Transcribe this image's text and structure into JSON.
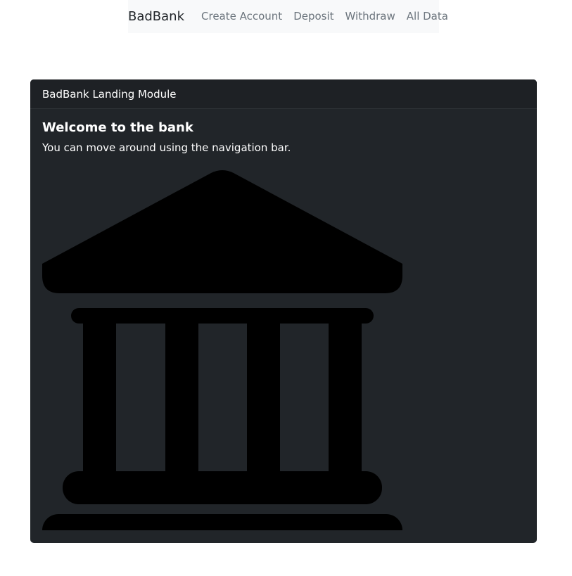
{
  "navbar": {
    "brand": "BadBank",
    "links": [
      "Create Account",
      "Deposit",
      "Withdraw",
      "All Data"
    ]
  },
  "card": {
    "header": "BadBank Landing Module",
    "title": "Welcome to the bank",
    "text": "You can move around using the navigation bar.",
    "image_icon": "bank-building-icon"
  },
  "colors": {
    "navbar_bg": "#f8f9fa",
    "card_bg": "#212529",
    "icon_fill": "#000000"
  }
}
